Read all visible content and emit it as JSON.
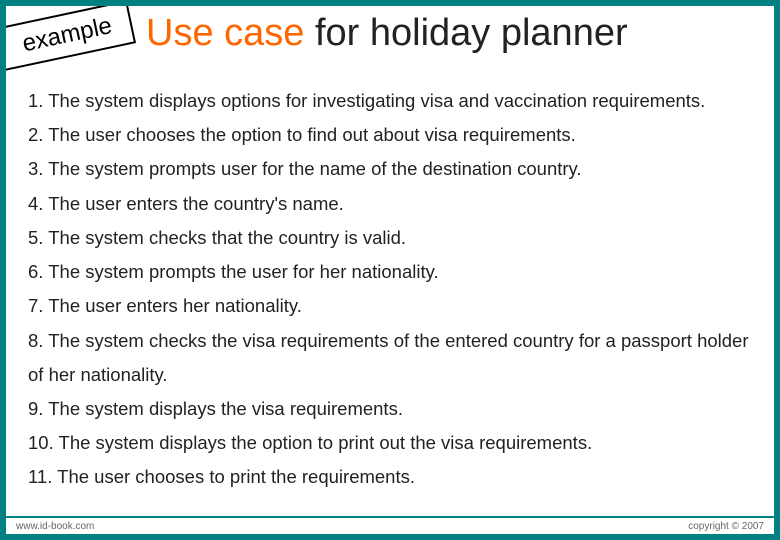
{
  "badge": "example",
  "title_accent": "Use case",
  "title_rest": " for holiday planner",
  "body_text": "1. The system displays options for investigating visa and vaccination requirements.\n2. The user chooses the option to find out about visa requirements.\n3. The system prompts user for the name of the destination country.\n4. The user enters the country's name.\n5. The system checks that the country is valid.\n6. The system prompts the user for her nationality.\n7. The user enters her nationality.\n8. The system checks the visa requirements of the entered country for a passport holder of her nationality.\n9. The system displays the visa requirements.\n10. The system displays the option to print out the visa requirements.\n11. The user chooses to print the requirements.",
  "footer_left": "www.id-book.com",
  "footer_right": "copyright © 2007"
}
